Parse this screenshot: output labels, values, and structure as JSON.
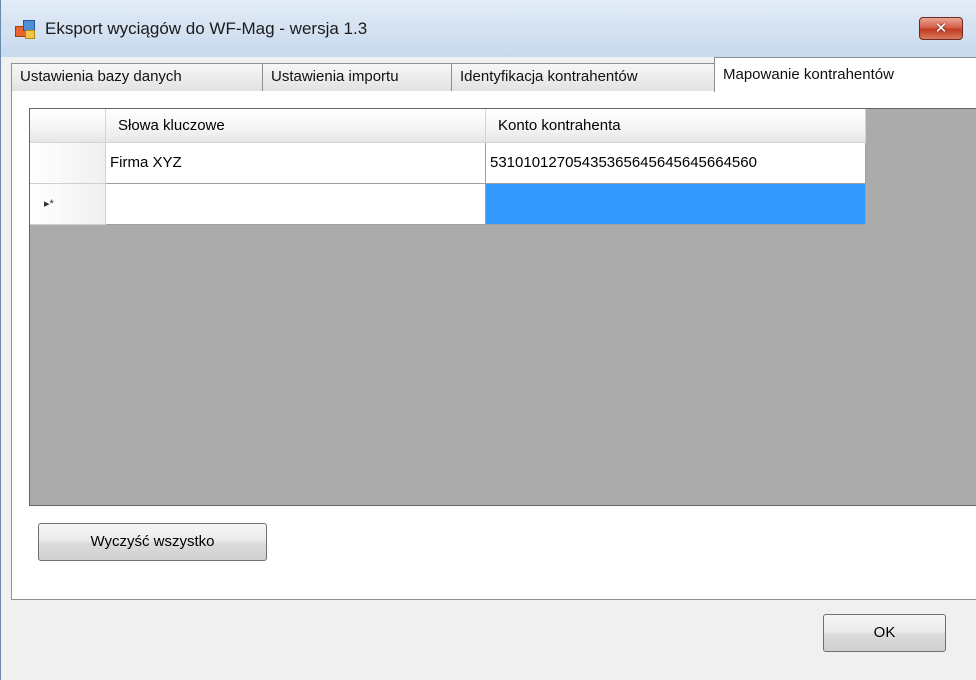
{
  "window": {
    "title": "Eksport wyciągów do WF-Mag - wersja 1.3",
    "close_label": "✕"
  },
  "tabs": [
    {
      "label": "Ustawienia bazy danych",
      "active": false
    },
    {
      "label": "Ustawienia importu",
      "active": false
    },
    {
      "label": "Identyfikacja kontrahentów",
      "active": false
    },
    {
      "label": "Mapowanie kontrahentów",
      "active": true
    }
  ],
  "grid": {
    "columns": [
      "Słowa kluczowe",
      "Konto kontrahenta"
    ],
    "rows": [
      {
        "row_marker": "",
        "cells": [
          "Firma XYZ",
          "53101012705435365645645645664560"
        ]
      },
      {
        "row_marker": "▸*",
        "cells": [
          "",
          ""
        ]
      }
    ],
    "selected_cell_color": "#3399ff"
  },
  "buttons": {
    "clear_all_label": "Wyczyść wszystko",
    "ok_label": "OK"
  }
}
